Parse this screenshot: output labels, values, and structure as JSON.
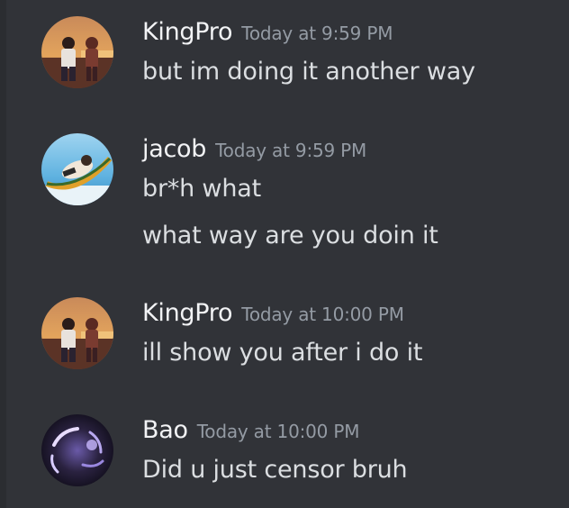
{
  "messages": [
    {
      "author": "KingPro",
      "timestamp": "Today at 9:59 PM",
      "avatar": "kingpro-anime-avatar",
      "lines": [
        "but im doing it another way"
      ]
    },
    {
      "author": "jacob",
      "timestamp": "Today at 9:59 PM",
      "avatar": "jacob-hammock-avatar",
      "lines": [
        "br*h what",
        "what way are you doin it"
      ]
    },
    {
      "author": "KingPro",
      "timestamp": "Today at 10:00 PM",
      "avatar": "kingpro-anime-avatar",
      "lines": [
        "ill show you after i do it"
      ]
    },
    {
      "author": "Bao",
      "timestamp": "Today at 10:00 PM",
      "avatar": "bao-glow-avatar",
      "lines": [
        "Did u just censor bruh"
      ]
    }
  ],
  "colors": {
    "background": "#313338",
    "username": "#f2f3f5",
    "timestamp": "#949ba4",
    "message_text": "#dbdee1"
  }
}
